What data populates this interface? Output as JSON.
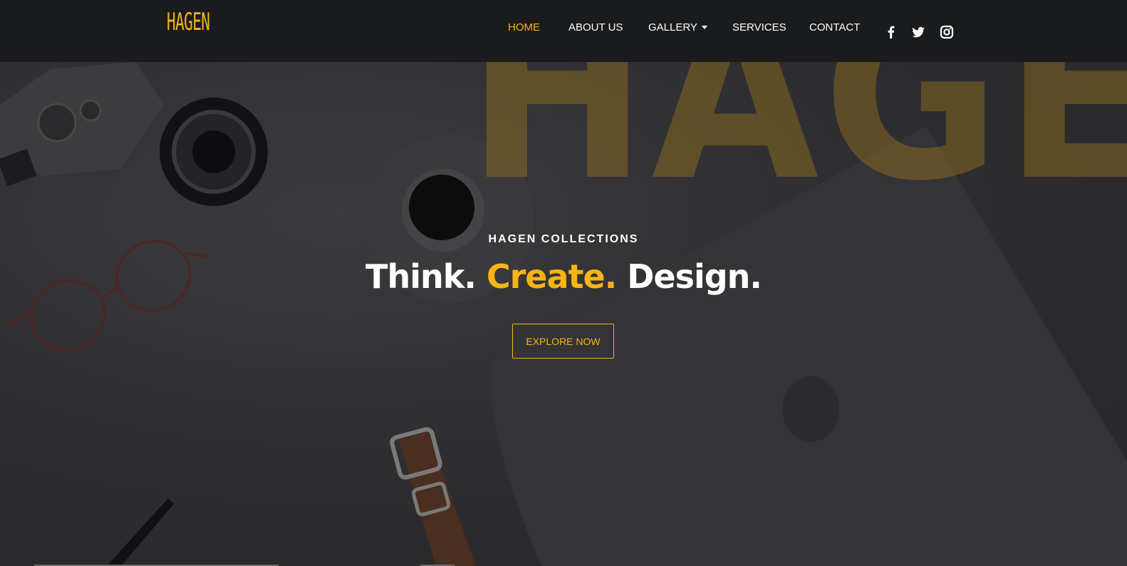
{
  "brand": {
    "logo_text": "HAGEN",
    "accent_color": "#f6b417"
  },
  "nav": {
    "items": [
      {
        "label": "HOME",
        "active": true
      },
      {
        "label": "ABOUT US",
        "active": false
      },
      {
        "label": "GALLERY",
        "active": false,
        "has_dropdown": true
      },
      {
        "label": "SERVICES",
        "active": false
      },
      {
        "label": "CONTACT",
        "active": false
      }
    ],
    "social": [
      "facebook-icon",
      "twitter-icon",
      "instagram-icon"
    ]
  },
  "hero": {
    "watermark": "HAGEN",
    "subtitle": "HAGEN COLLECTIONS",
    "title_part1": "Think.",
    "title_part2": "Create.",
    "title_part3": "Design.",
    "cta_label": "EXPLORE NOW"
  }
}
